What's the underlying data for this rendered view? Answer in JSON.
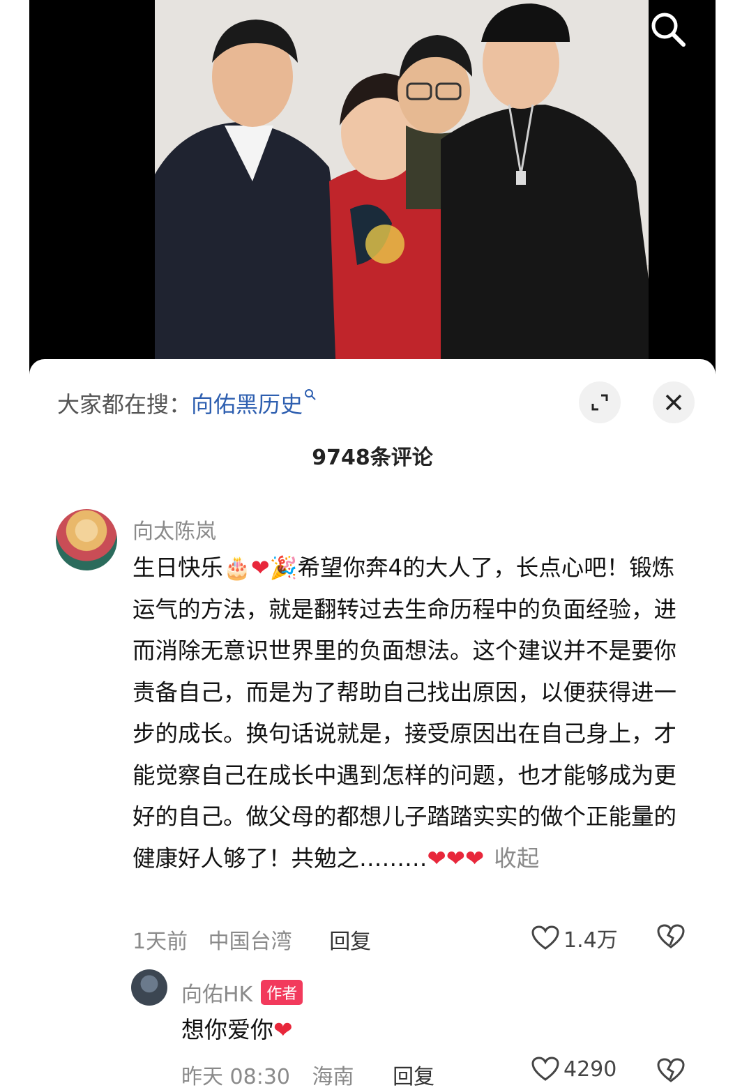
{
  "hot_search": {
    "prefix": "大家都在搜：",
    "keyword": "向佑黑历史"
  },
  "icons": {
    "search": "search-icon",
    "expand": "expand-icon",
    "close": "close-icon",
    "like": "heart-outline-icon",
    "dislike": "broken-heart-icon"
  },
  "comments_count": "9748条评论",
  "comment": {
    "user": "向太陈岚",
    "text_part1": "生日快乐",
    "text_part2": "希望你奔4的大人了，长点心吧！锻炼运气的方法，就是翻转过去生命历程中的负面经验，进而消除无意识世界里的负面想法。这个建议并不是要你责备自己，而是为了帮助自己找出原因，以便获得进一步的成长。换句话说就是，接受原因出在自己身上，才能觉察自己在成长中遇到怎样的问题，也才能够成为更好的自己。做父母的都想儿子踏踏实实的做个正能量的健康好人够了！共勉之………",
    "collapse": "收起",
    "time": "1天前",
    "location": "中国台湾",
    "reply": "回复",
    "likes": "1.4万"
  },
  "reply": {
    "user": "向佑HK",
    "badge": "作者",
    "text": "想你爱你",
    "time": "昨天 08:30",
    "location": "海南",
    "reply": "回复",
    "likes": "4290"
  },
  "colors": {
    "accent": "#f23a5c",
    "link": "#2e5fb0",
    "heart": "#e8273b"
  }
}
